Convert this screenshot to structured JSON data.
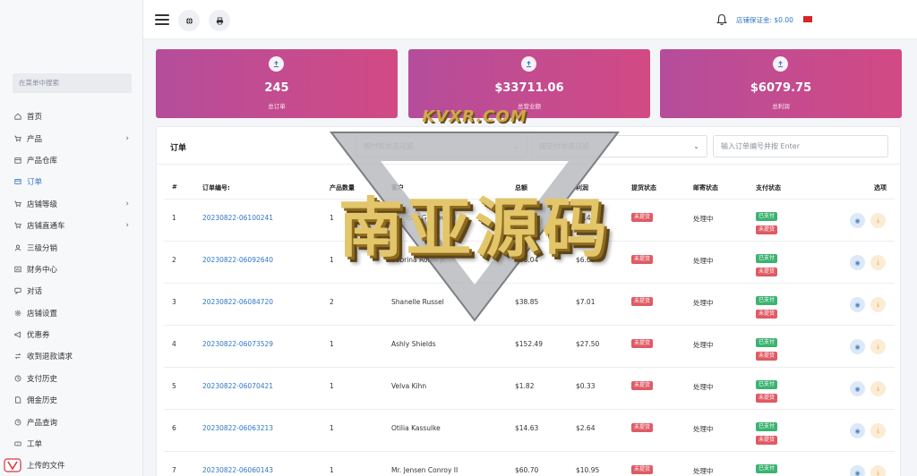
{
  "sidebar": {
    "search_placeholder": "在菜单中搜索",
    "items": [
      {
        "label": "首页",
        "icon": "home-icon",
        "chevron": ""
      },
      {
        "label": "产品",
        "icon": "cart-icon",
        "chevron": "›"
      },
      {
        "label": "产品仓库",
        "icon": "warehouse-icon",
        "chevron": ""
      },
      {
        "label": "订单",
        "icon": "orders-icon",
        "chevron": ""
      },
      {
        "label": "店铺等级",
        "icon": "cart-icon",
        "chevron": "›"
      },
      {
        "label": "店铺直通车",
        "icon": "cart-icon",
        "chevron": "›"
      },
      {
        "label": "三级分销",
        "icon": "user-icon",
        "chevron": ""
      },
      {
        "label": "财务中心",
        "icon": "finance-icon",
        "chevron": ""
      },
      {
        "label": "对话",
        "icon": "chat-icon",
        "chevron": ""
      },
      {
        "label": "店铺设置",
        "icon": "settings-icon",
        "chevron": ""
      },
      {
        "label": "优惠券",
        "icon": "megaphone-icon",
        "chevron": ""
      },
      {
        "label": "收到退款请求",
        "icon": "refund-icon",
        "chevron": ""
      },
      {
        "label": "支付历史",
        "icon": "history-icon",
        "chevron": ""
      },
      {
        "label": "佣金历史",
        "icon": "document-icon",
        "chevron": ""
      },
      {
        "label": "产品查询",
        "icon": "clock-icon",
        "chevron": ""
      },
      {
        "label": "工单",
        "icon": "ticket-icon",
        "chevron": ""
      },
      {
        "label": "上传的文件",
        "icon": "folder-icon",
        "chevron": ""
      }
    ]
  },
  "header": {
    "balance_label": "店铺保证金: $0.00"
  },
  "stats": [
    {
      "value": "245",
      "label": "总订单"
    },
    {
      "value": "$33711.06",
      "label": "总营业额"
    },
    {
      "value": "$6079.75",
      "label": "总利润"
    }
  ],
  "orders": {
    "title": "订单",
    "filter_payment": "按付款状态过滤",
    "filter_delivery": "按交付状态过滤",
    "search_placeholder": "输入订单编号并按 Enter",
    "columns": [
      "#",
      "订单编号:",
      "产品数量",
      "客户",
      "总额",
      "利润",
      "提货状态",
      "邮寄状态",
      "支付状态",
      "选项"
    ],
    "rows": [
      {
        "idx": "1",
        "code": "20230822-06100241",
        "qty": "1",
        "customer": "Camden Gulgowski",
        "total": "$24.19",
        "profit": "$4.40",
        "pickup": "未提货",
        "shipping": "处理中",
        "paid": "已支付",
        "pstatus": "未提货"
      },
      {
        "idx": "2",
        "code": "20230822-06092640",
        "qty": "1",
        "customer": "Sabrina Robel Jr.",
        "total": "$36.04",
        "profit": "$6.60",
        "pickup": "未提货",
        "shipping": "处理中",
        "paid": "已支付",
        "pstatus": "未提货"
      },
      {
        "idx": "3",
        "code": "20230822-06084720",
        "qty": "2",
        "customer": "Shanelle Russel",
        "total": "$38.85",
        "profit": "$7.01",
        "pickup": "未提货",
        "shipping": "处理中",
        "paid": "已支付",
        "pstatus": "未提货"
      },
      {
        "idx": "4",
        "code": "20230822-06073529",
        "qty": "1",
        "customer": "Ashly Shields",
        "total": "$152.49",
        "profit": "$27.50",
        "pickup": "未提货",
        "shipping": "处理中",
        "paid": "已支付",
        "pstatus": "未提货"
      },
      {
        "idx": "5",
        "code": "20230822-06070421",
        "qty": "1",
        "customer": "Velva Kihn",
        "total": "$1.82",
        "profit": "$0.33",
        "pickup": "未提货",
        "shipping": "处理中",
        "paid": "已支付",
        "pstatus": "未提货"
      },
      {
        "idx": "6",
        "code": "20230822-06063213",
        "qty": "1",
        "customer": "Otilia Kassulke",
        "total": "$14.63",
        "profit": "$2.64",
        "pickup": "未提货",
        "shipping": "处理中",
        "paid": "已支付",
        "pstatus": "未提货"
      },
      {
        "idx": "7",
        "code": "20230822-06060143",
        "qty": "1",
        "customer": "Mr. Jensen Conroy II",
        "total": "$60.70",
        "profit": "$10.95",
        "pickup": "未提货",
        "shipping": "处理中",
        "paid": "已支付",
        "pstatus": "未提货"
      }
    ]
  },
  "watermark": {
    "top_text": "KVXR.COM",
    "main_text": "南亚源码"
  },
  "colors": {
    "accent": "#2f76c8",
    "card_gradient_start": "#b54d9b",
    "card_gradient_end": "#d24a84",
    "badge_green": "#3cb371",
    "badge_red": "#e05a64"
  }
}
